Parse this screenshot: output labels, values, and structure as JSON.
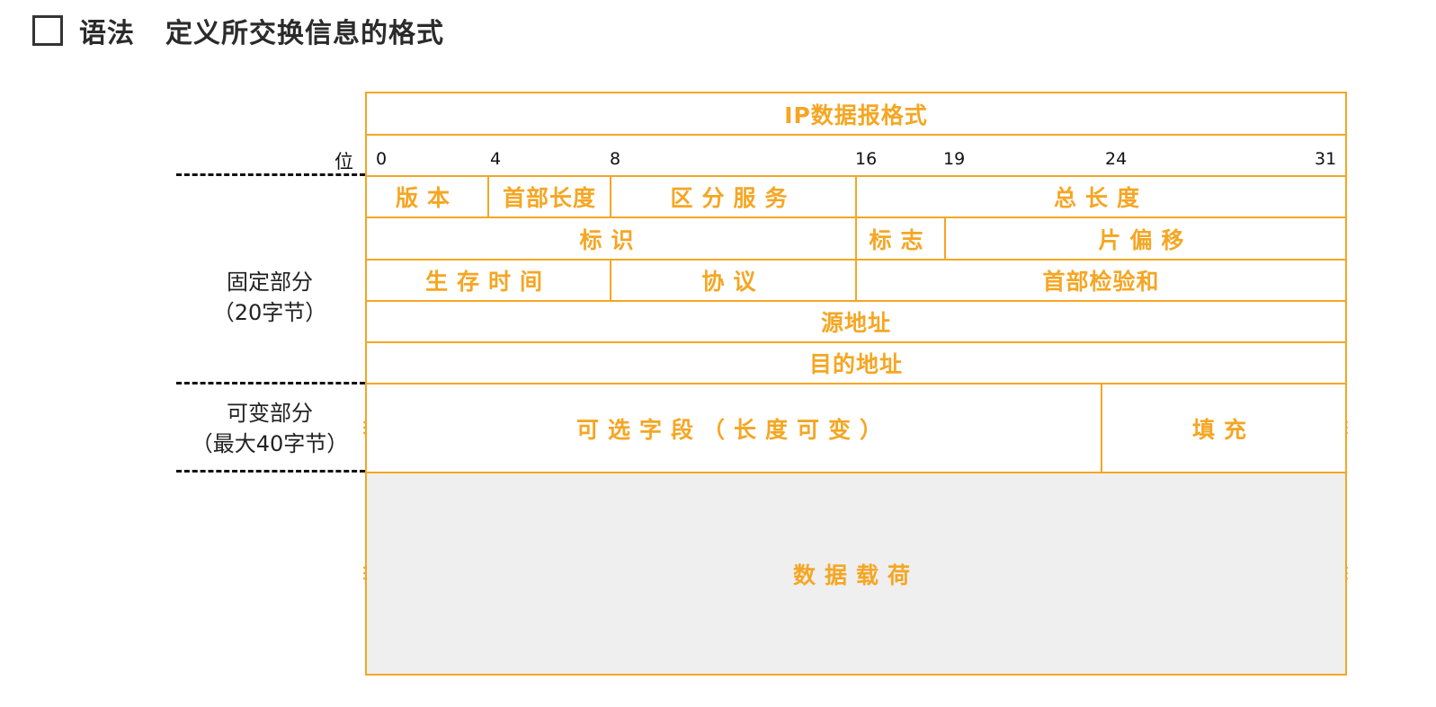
{
  "header": {
    "title": "语法",
    "subtitle": "定义所交换信息的格式",
    "checkbox_icon": "empty-square-icon"
  },
  "diagram": {
    "caption": "IP数据报格式",
    "bit_axis_label": "位",
    "bit_positions": [
      "0",
      "4",
      "8",
      "16",
      "19",
      "24",
      "31"
    ],
    "fields": {
      "version": "版本",
      "header_length": "首部长度",
      "tos": "区分服务",
      "total_length": "总长度",
      "identification": "标识",
      "flags": "标志",
      "fragment_offset": "片偏移",
      "ttl": "生存时间",
      "protocol": "协议",
      "checksum": "首部检验和",
      "source": "源地址",
      "destination": "目的地址",
      "options": "可选字段（长度可变）",
      "padding": "填充",
      "payload": "数据载荷"
    },
    "sections": {
      "fixed_title": "固定部分",
      "fixed_size": "（20字节）",
      "variable_title": "可变部分",
      "variable_size": "（最大40字节）"
    },
    "colors": {
      "accent": "#f5a623",
      "payload_fill": "#efefef",
      "text": "#222222"
    }
  }
}
